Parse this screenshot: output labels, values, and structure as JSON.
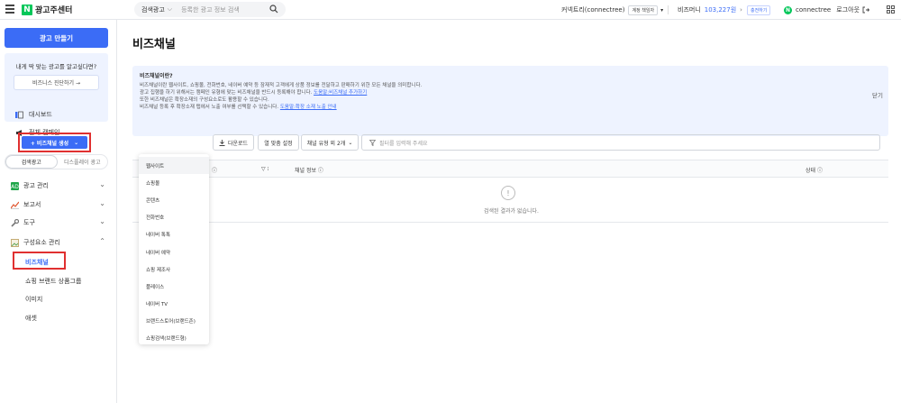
{
  "header": {
    "logo_letter": "N",
    "logo_text": "광고주센터",
    "search_category": "검색광고",
    "search_placeholder": "등록한 광고 정보 검색",
    "account_name": "커넥트리(connectree)",
    "account_badge": "계정 책임자",
    "bizmoney_label": "비즈머니",
    "bizmoney_value": "103,227원",
    "charge_label": "충전하기",
    "user_chip": "N",
    "user_name": "connectree",
    "logout_label": "로그아웃"
  },
  "sidebar": {
    "create_button": "광고 만들기",
    "promo_question": "내게 딱 맞는 광고를 알고싶다면?",
    "promo_button": "비즈니스 진단하기 →",
    "dashboard": "대시보드",
    "all_campaigns": "전체 캠페인",
    "tabs": [
      "검색광고",
      "디스플레이 광고"
    ],
    "menu": {
      "ad_manage": "광고 관리",
      "report": "보고서",
      "tools": "도구",
      "components": "구성요소 관리"
    },
    "sub_items": [
      "비즈채널",
      "쇼핑 브랜드 상품그룹",
      "이미지",
      "애셋"
    ]
  },
  "main": {
    "title": "비즈채널",
    "info": {
      "heading": "비즈채널이란?",
      "line1": "비즈채널이란 웹사이트, 쇼핑몰, 전화번호, 네이버 예약 등 잠재적 고객에게 상품 정보를 전달하고 판매하기 위한 모든 채널을 의미합니다.",
      "line2": "광고 집행을 하기 위해서는 캠페인 유형에 맞는 비즈채널을 반드시 등록해야 합니다.",
      "line2_link": "도움말:비즈채널 추가하기",
      "line3": "또한 비즈채널은 확장소재의 구성요소로도 활용할 수 있습니다.",
      "line4": "비즈채널 등록 후 확장소재 탭에서 노출 여부를 선택할 수 있습니다.",
      "line4_link": "도움말:확장 소재 노출 안내",
      "close": "닫기"
    },
    "toolbar": {
      "create": "+ 비즈채널 생성",
      "download": "다운로드",
      "column_settings": "열 맞춤 설정",
      "channel_type": "채널 유형 외 2개",
      "filter_placeholder": "필터를 입력해 주세요"
    },
    "table": {
      "col_channel_info": "채널 정보",
      "col_status": "상태",
      "empty_message": "검색된 결과가 없습니다."
    },
    "dropdown_options": [
      "웹사이트",
      "쇼핑몰",
      "콘텐츠",
      "전화번호",
      "네이버 톡톡",
      "네이버 예약",
      "쇼핑 제조사",
      "플레이스",
      "네이버 TV",
      "브랜드스토어(브랜드존)",
      "쇼핑검색(브랜드형)"
    ]
  }
}
